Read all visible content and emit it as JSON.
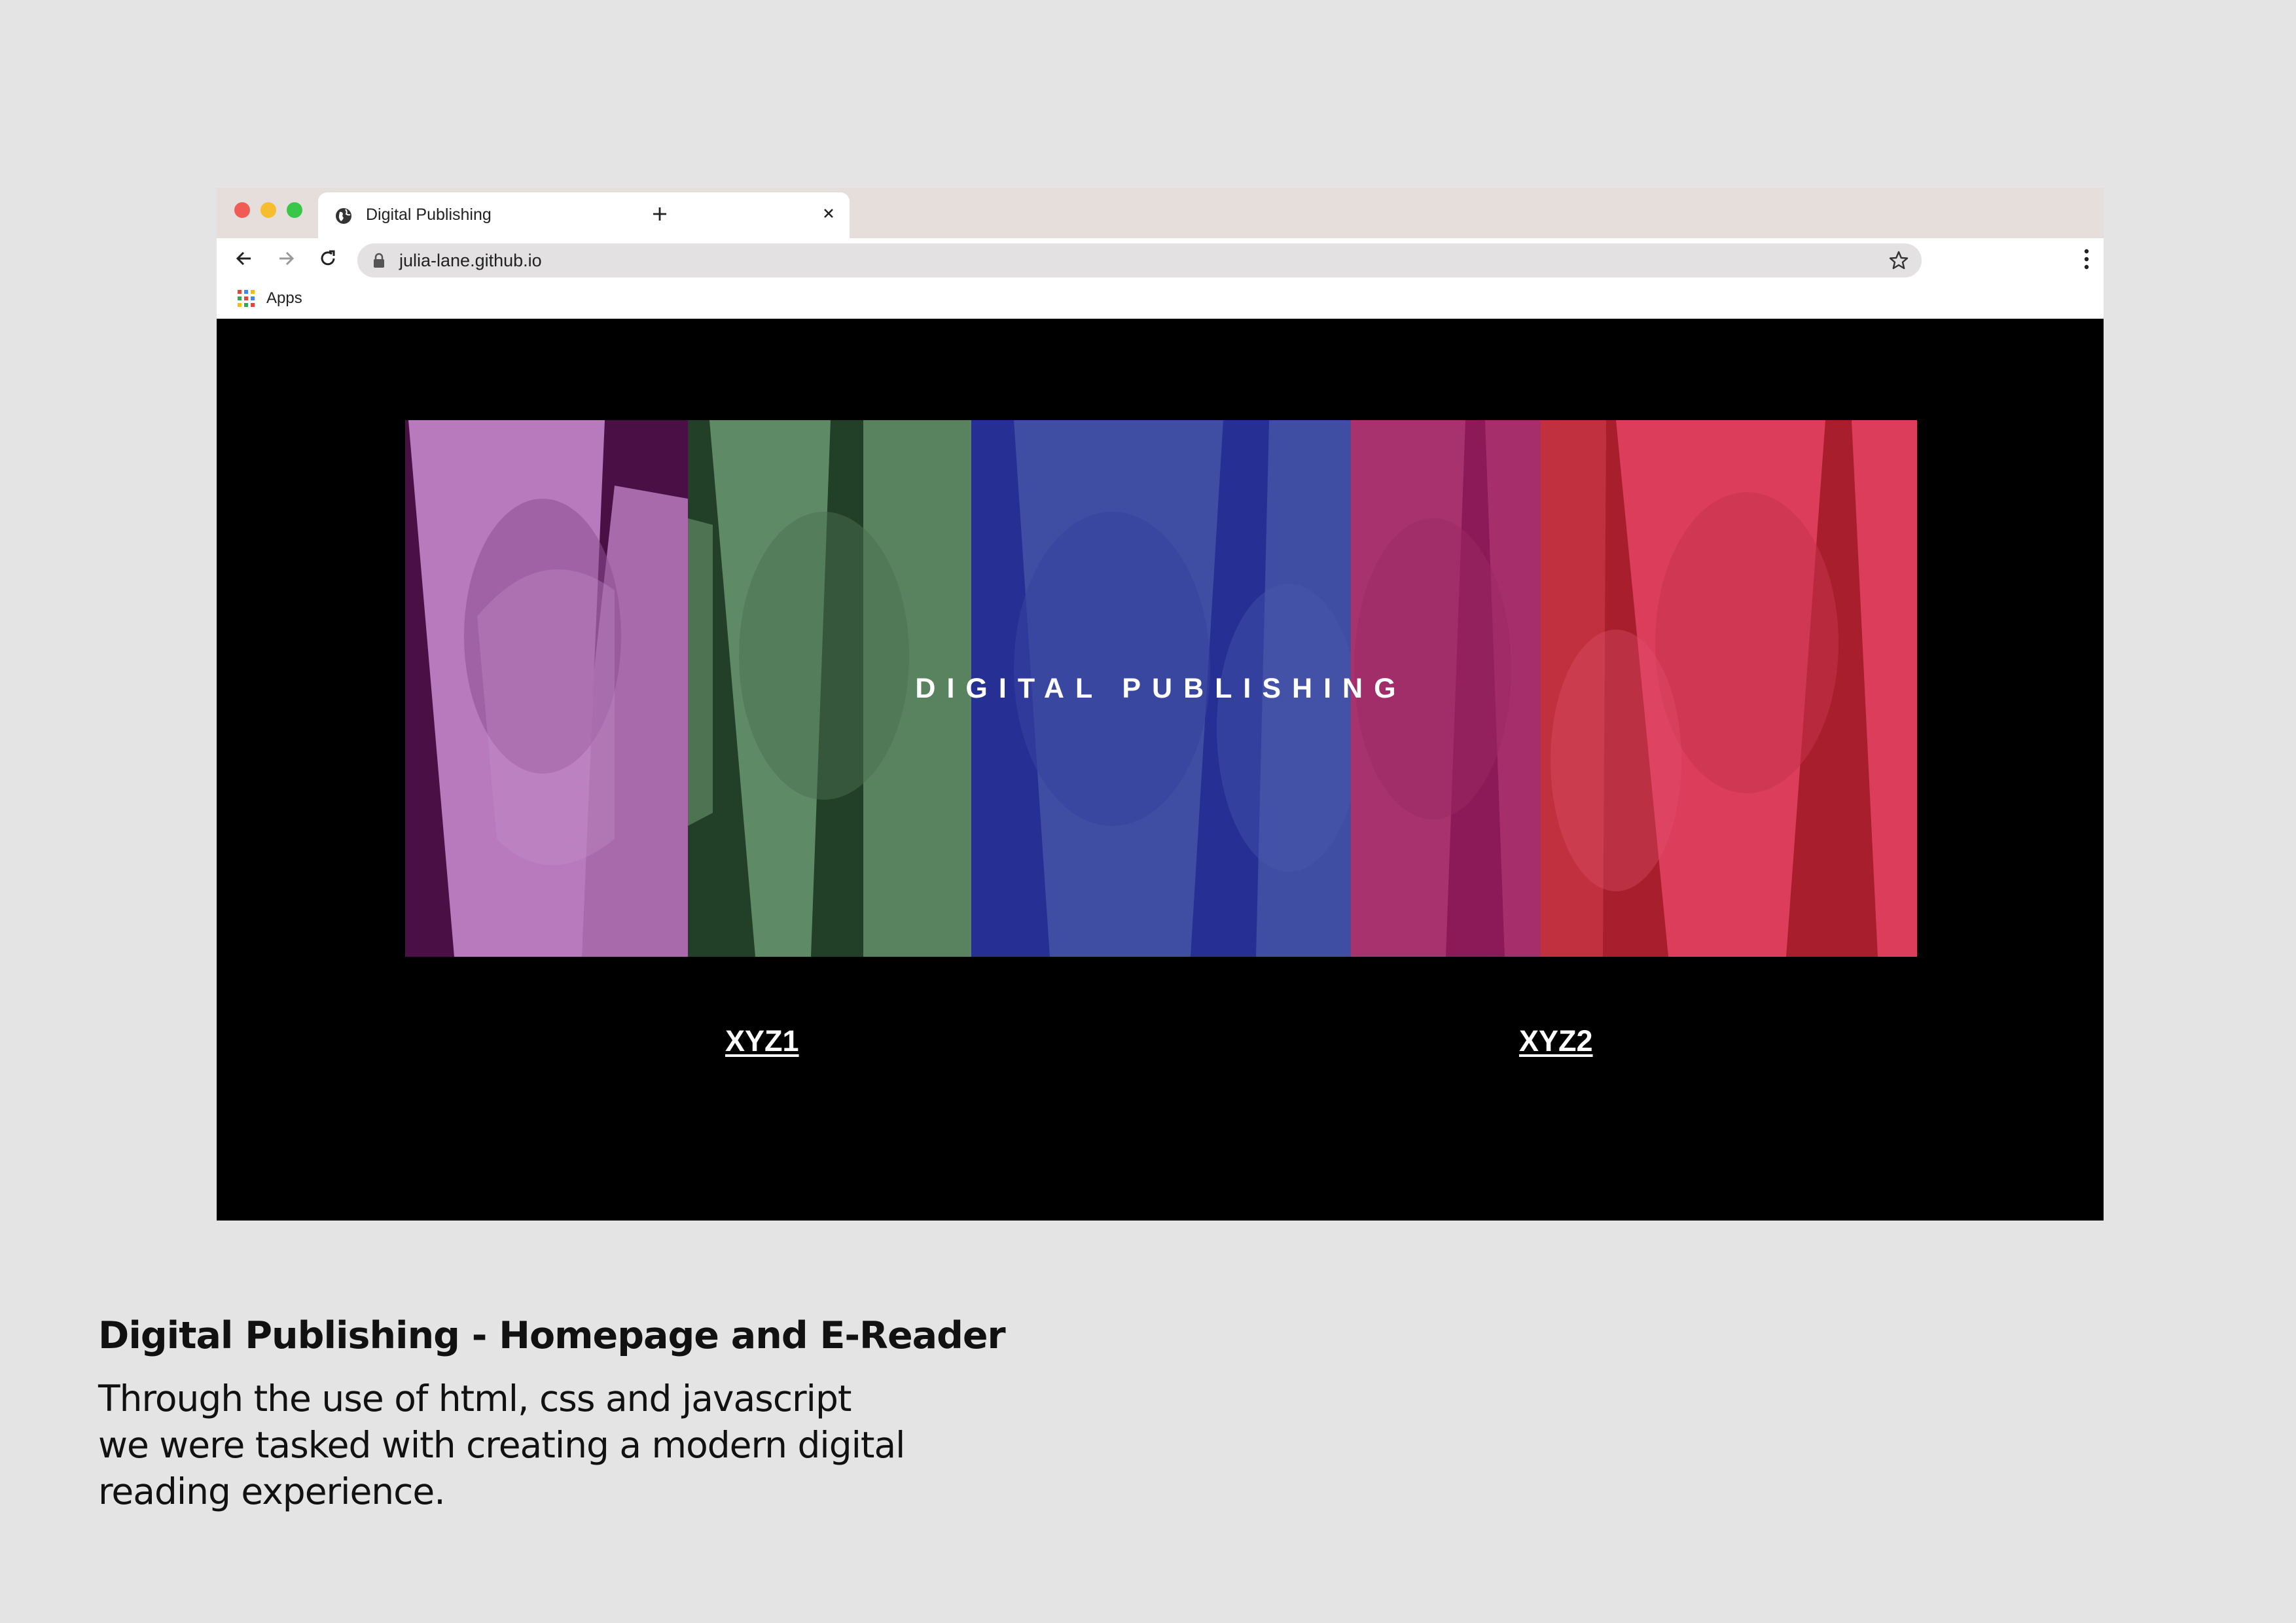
{
  "browser": {
    "tab": {
      "title": "Digital Publishing",
      "favicon": "globe-icon",
      "close": "close-icon"
    },
    "new_tab": "plus-icon",
    "nav": {
      "back": "back-arrow-icon",
      "forward": "forward-arrow-icon",
      "reload": "reload-icon"
    },
    "address": {
      "url": "julia-lane.github.io",
      "lock": "lock-icon",
      "bookmark": "star-icon"
    },
    "menu": "more-vertical-icon",
    "bookmarks_bar": {
      "apps_label": "Apps",
      "apps_icon": "apps-grid-icon"
    },
    "traffic_lights": [
      "#f05c53",
      "#f6bd2f",
      "#38c748"
    ]
  },
  "page": {
    "hero_title": "DIGITAL PUBLISHING",
    "hero_panels": [
      {
        "name": "purple",
        "light": "#b97abd",
        "dark": "#4a0f45"
      },
      {
        "name": "green",
        "light": "#5f8a66",
        "dark": "#223f27"
      },
      {
        "name": "blue",
        "light": "#3f4ea3",
        "dark": "#262f93"
      },
      {
        "name": "magenta",
        "light": "#a8326e",
        "dark": "#8c1a58"
      },
      {
        "name": "red",
        "light": "#dc3d5b",
        "dark": "#a81e2d"
      }
    ],
    "links": [
      "XYZ1",
      "XYZ2"
    ]
  },
  "caption": {
    "title": "Digital Publishing - Homepage and E-Reader",
    "body": "Through the use of html, css and javascript\nwe were tasked with creating a modern digital\nreading experience."
  }
}
